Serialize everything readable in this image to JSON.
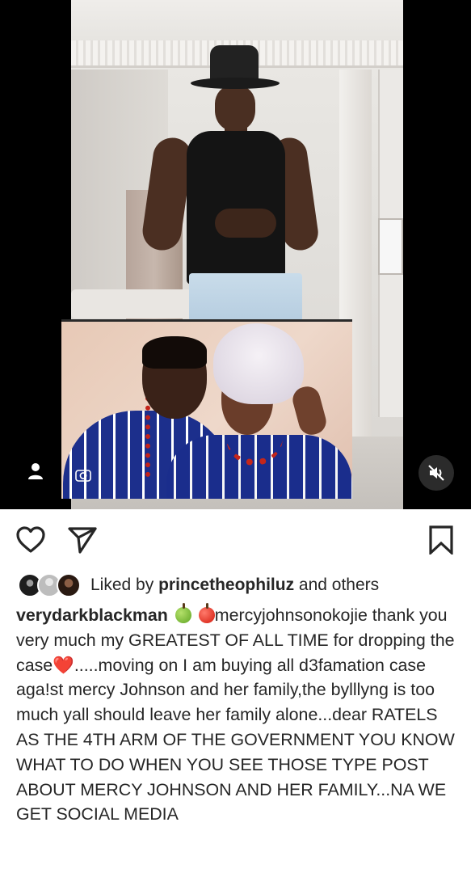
{
  "post": {
    "liked_by_prefix": "Liked by",
    "liked_by_user": "princetheophiluz",
    "liked_by_suffix": "and others",
    "caption": {
      "username": "verydarkblackman",
      "emoji_1": "green-apple",
      "emoji_2": "red-apple",
      "mention": "mercyjohnsonokojie",
      "text_1": " thank you very much my GREATEST OF ALL TIME for dropping the case",
      "heart": "❤️",
      "text_2": ".....moving on I am buying all d3famation case aga!st mercy Johnson and her family,the bylllyng is too much yall should leave her family alone...dear RATELS AS THE 4TH ARM OF THE GOVERNMENT YOU KNOW WHAT TO DO WHEN YOU SEE THOSE TYPE POST ABOUT MERCY JOHNSON AND HER FAMILY...NA WE GET SOCIAL MEDIA"
    }
  },
  "icons": {
    "like": "heart-outline-icon",
    "share": "paper-plane-icon",
    "save": "bookmark-icon",
    "tagged": "user-icon",
    "mute": "speaker-muted-icon"
  },
  "colors": {
    "text": "#262626",
    "background": "#ffffff",
    "media_background": "#000000"
  }
}
